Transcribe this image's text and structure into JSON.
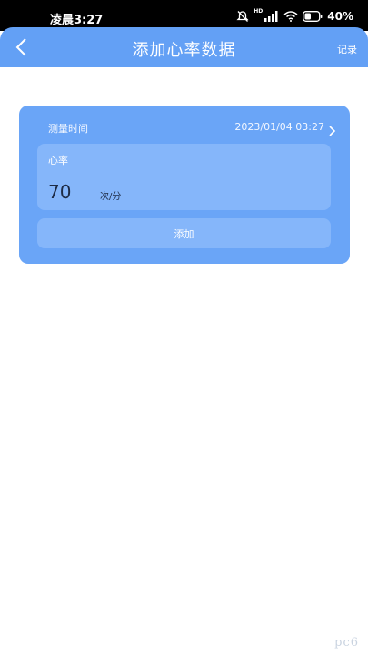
{
  "status_bar": {
    "time": "凌晨3:27",
    "network_badge": "HD",
    "battery": "40%",
    "icons": [
      "bell-muted-icon",
      "signal-icon",
      "wifi-icon",
      "battery-icon"
    ]
  },
  "header": {
    "title": "添加心率数据",
    "records_label": "记录",
    "background_color": "#63a0f5"
  },
  "form": {
    "time_label": "测量时间",
    "time_value": "2023/01/04 03:27",
    "heart_rate_label": "心率",
    "heart_rate_value": "70",
    "heart_rate_unit": "次/分",
    "add_button_label": "添加",
    "card_color": "#6aa5f7"
  },
  "watermark": "pc6"
}
